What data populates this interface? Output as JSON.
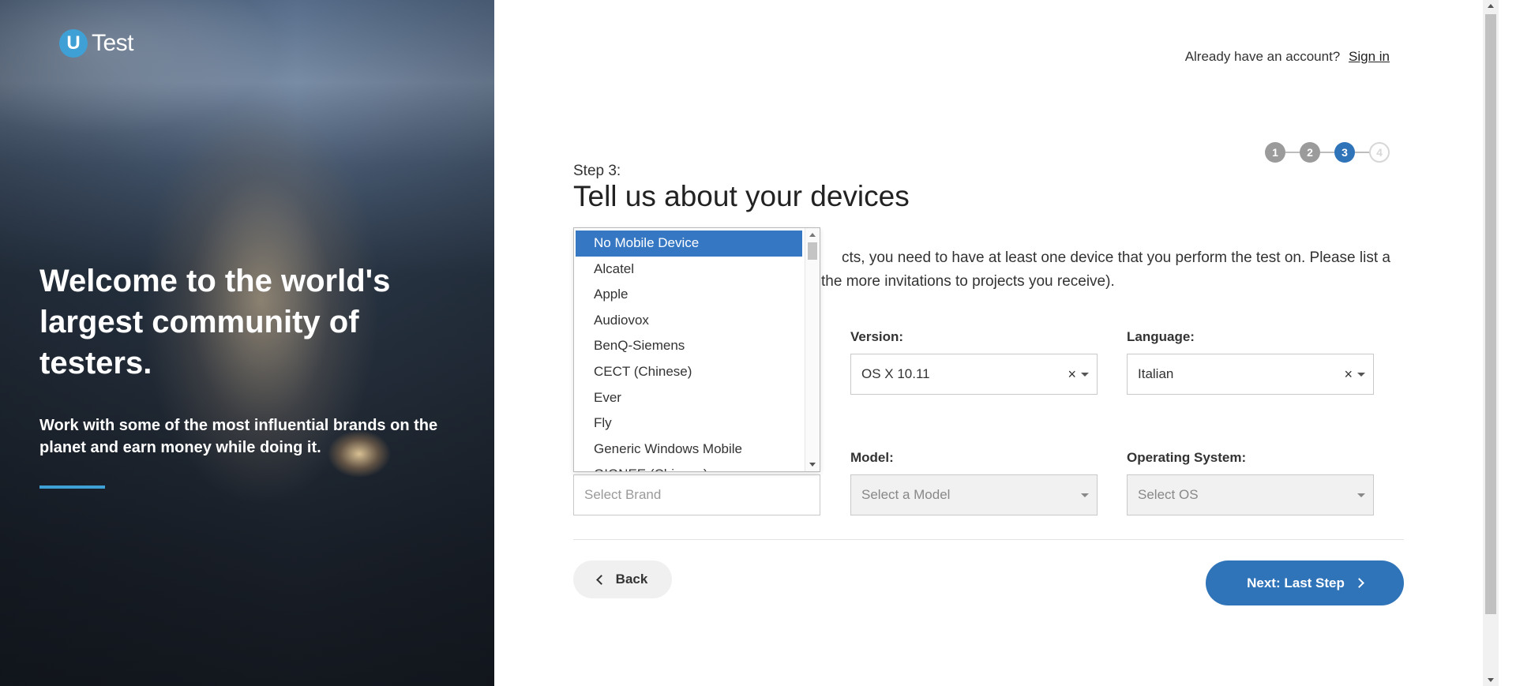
{
  "hero": {
    "logo_letter": "U",
    "logo_text": "Test",
    "title": "Welcome to the world's largest community of testers.",
    "subtitle": "Work with some of the most influential brands on the planet and earn money while doing it."
  },
  "header": {
    "account_prompt": "Already have an account?",
    "signin_label": "Sign in"
  },
  "progress": {
    "steps": [
      "1",
      "2",
      "3",
      "4"
    ],
    "current": 3
  },
  "page": {
    "step_label": "Step 3:",
    "title": "Tell us about your devices",
    "intro_line1": "cts, you need to have at least one device that you perform the test on. Please list a",
    "intro_line2": "the more invitations to projects you receive)."
  },
  "desktop": {
    "version_label": "Version:",
    "version_value": "OS X 10.11",
    "language_label": "Language:",
    "language_value": "Italian"
  },
  "mobile": {
    "brand_placeholder": "Select Brand",
    "model_label": "Model:",
    "model_placeholder": "Select a Model",
    "os_label": "Operating System:",
    "os_placeholder": "Select OS"
  },
  "brand_dropdown": {
    "options": [
      "No Mobile Device",
      "Alcatel",
      "Apple",
      "Audiovox",
      "BenQ-Siemens",
      "CECT (Chinese)",
      "Ever",
      "Fly",
      "Generic Windows Mobile",
      "GIONEE (Chinese)"
    ],
    "highlighted": "No Mobile Device"
  },
  "buttons": {
    "back_label": "Back",
    "next_label": "Next: Last Step"
  },
  "colors": {
    "primary": "#2f73b8",
    "accent": "#3fa0d6"
  }
}
